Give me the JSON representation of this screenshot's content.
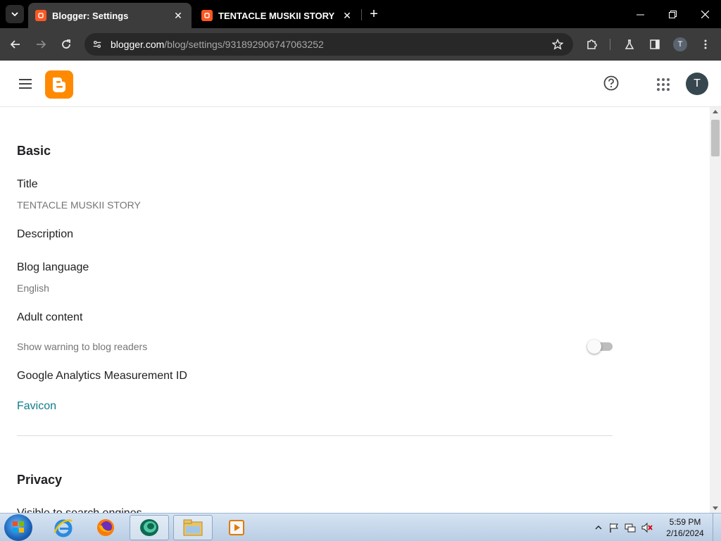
{
  "browser": {
    "tabs": [
      {
        "title": "Blogger: Settings",
        "active": true
      },
      {
        "title": "TENTACLE MUSKII STORY",
        "active": false
      }
    ],
    "url_host": "blogger.com",
    "url_path": "/blog/settings/931892906747063252",
    "profile_initial": "T"
  },
  "header": {
    "avatar_initial": "T"
  },
  "settings": {
    "basic_heading": "Basic",
    "title_label": "Title",
    "title_value": "TENTACLE MUSKII STORY",
    "description_label": "Description",
    "language_label": "Blog language",
    "language_value": "English",
    "adult_label": "Adult content",
    "adult_desc": "Show warning to blog readers",
    "adult_enabled": false,
    "analytics_label": "Google Analytics Measurement ID",
    "favicon_label": "Favicon",
    "privacy_heading": "Privacy",
    "search_visible_label": "Visible to search engines"
  },
  "taskbar": {
    "time": "5:59 PM",
    "date": "2/16/2024"
  },
  "colors": {
    "accent": "#0f7c8c",
    "blogger_orange": "#ff8a00",
    "browser_dark": "#3c3c3c"
  }
}
